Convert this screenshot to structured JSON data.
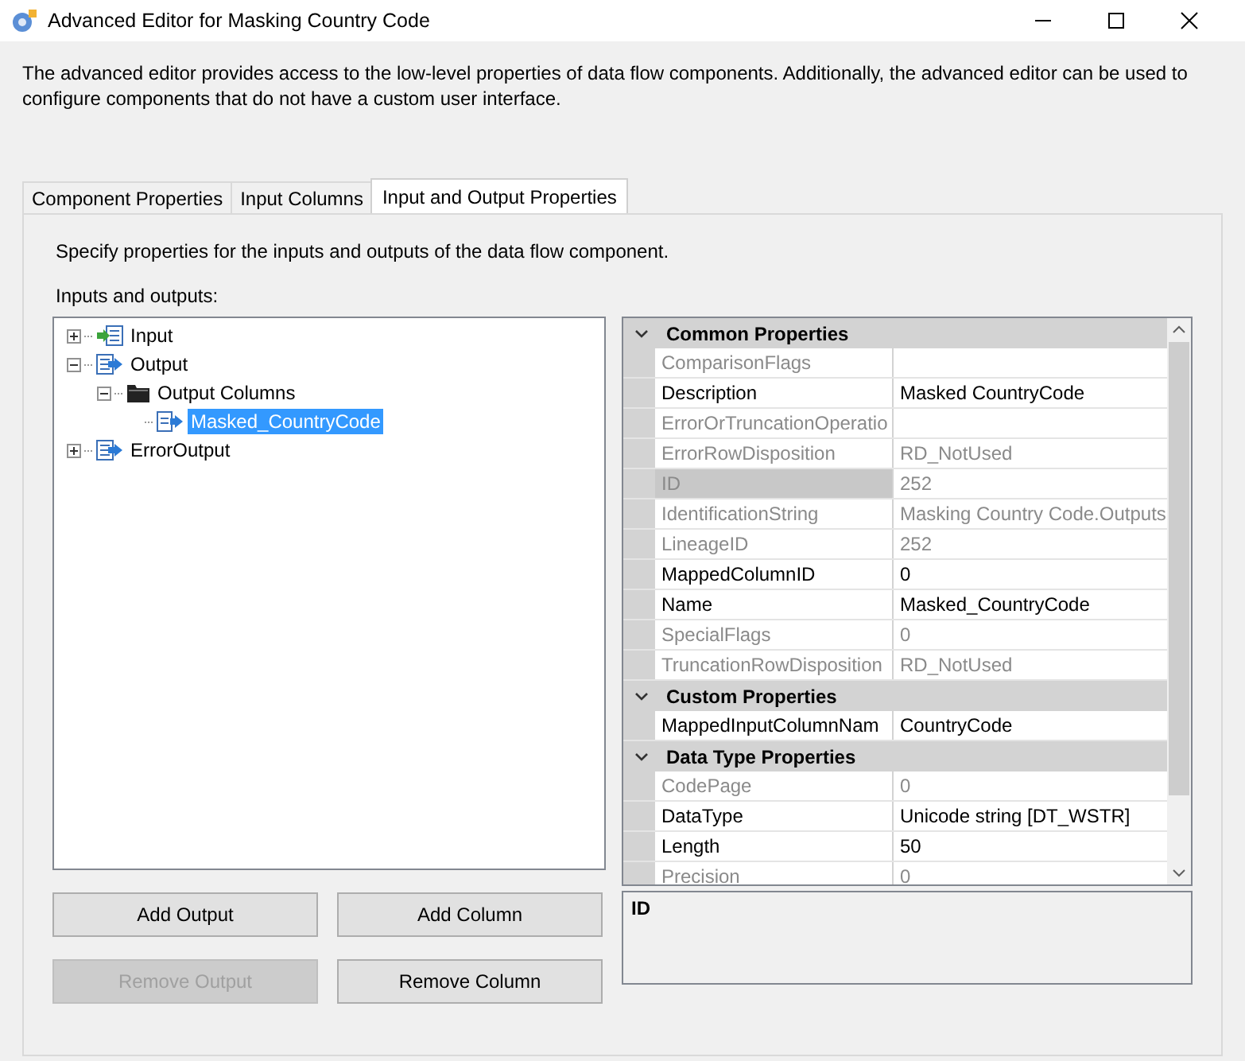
{
  "window": {
    "title": "Advanced Editor for Masking Country Code"
  },
  "description": "The advanced editor provides access to the low-level properties of data flow components. Additionally, the advanced editor can be used to configure components that do not have a custom user interface.",
  "tabs": [
    {
      "label": "Component Properties",
      "selected": false
    },
    {
      "label": "Input Columns",
      "selected": false
    },
    {
      "label": "Input and Output Properties",
      "selected": true
    }
  ],
  "instruction": "Specify properties for the inputs and outputs of the data flow component.",
  "tree_label": "Inputs and outputs:",
  "tree": [
    {
      "label": "Input",
      "kind": "input",
      "expanded": false,
      "selected": false
    },
    {
      "label": "Output",
      "kind": "output",
      "expanded": true,
      "selected": false,
      "children": [
        {
          "label": "Output Columns",
          "kind": "folder",
          "expanded": true,
          "selected": false,
          "children": [
            {
              "label": "Masked_CountryCode",
              "kind": "column",
              "selected": true
            }
          ]
        }
      ]
    },
    {
      "label": "ErrorOutput",
      "kind": "output",
      "expanded": false,
      "selected": false
    }
  ],
  "properties": [
    {
      "category": "Common Properties",
      "expanded": true,
      "rows": [
        {
          "name": "ComparisonFlags",
          "readonly": true,
          "selected": false
        },
        {
          "name": "Description",
          "value": "Masked CountryCode",
          "readonly": false,
          "selected": false
        },
        {
          "name": "ErrorOrTruncationOperatio",
          "readonly": true,
          "selected": false
        },
        {
          "name": "ErrorRowDisposition",
          "value": "RD_NotUsed",
          "readonly": true,
          "selected": false
        },
        {
          "name": "ID",
          "value": "252",
          "readonly": true,
          "selected": true
        },
        {
          "name": "IdentificationString",
          "value": "Masking Country Code.Outputs",
          "readonly": true,
          "selected": false
        },
        {
          "name": "LineageID",
          "value": "252",
          "readonly": true,
          "selected": false
        },
        {
          "name": "MappedColumnID",
          "value": "0",
          "readonly": false,
          "selected": false
        },
        {
          "name": "Name",
          "value": "Masked_CountryCode",
          "readonly": false,
          "selected": false
        },
        {
          "name": "SpecialFlags",
          "value": "0",
          "readonly": true,
          "selected": false
        },
        {
          "name": "TruncationRowDisposition",
          "value": "RD_NotUsed",
          "readonly": true,
          "selected": false
        }
      ]
    },
    {
      "category": "Custom Properties",
      "expanded": true,
      "rows": [
        {
          "name": "MappedInputColumnNam",
          "value": "CountryCode",
          "readonly": false,
          "selected": false
        }
      ]
    },
    {
      "category": "Data Type Properties",
      "expanded": true,
      "rows": [
        {
          "name": "CodePage",
          "value": "0",
          "readonly": true,
          "selected": false
        },
        {
          "name": "DataType",
          "value": "Unicode string [DT_WSTR]",
          "readonly": false,
          "selected": false
        },
        {
          "name": "Length",
          "value": "50",
          "readonly": false,
          "selected": false
        },
        {
          "name": "Precision",
          "value": "0",
          "readonly": true,
          "selected": false
        }
      ]
    }
  ],
  "property_description": {
    "title": "ID"
  },
  "buttons": [
    {
      "label": "Add Output",
      "disabled": false
    },
    {
      "label": "Add Column",
      "disabled": false
    },
    {
      "label": "Remove Output",
      "disabled": true
    },
    {
      "label": "Remove Column",
      "disabled": false
    }
  ]
}
